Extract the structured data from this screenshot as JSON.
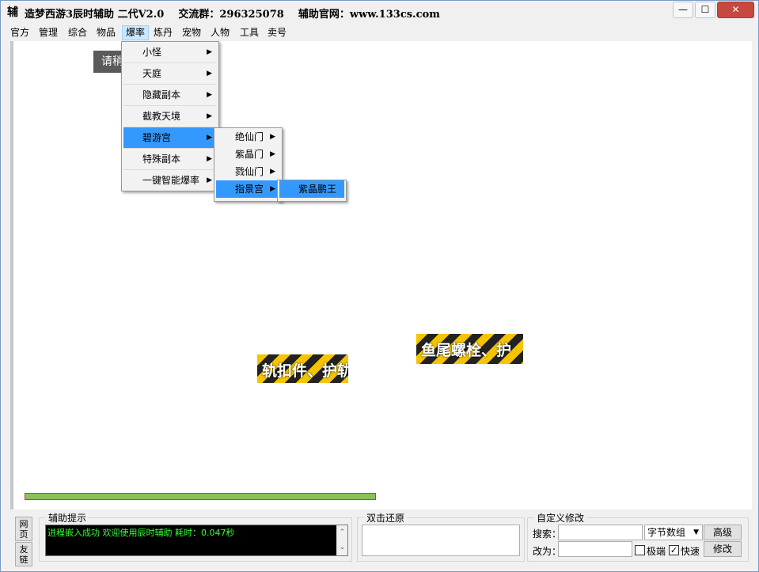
{
  "window": {
    "icon_glyph": "辅",
    "title": "造梦西游3辰时辅助 二代V2.0    交流群：296325078    辅助官网：www.133cs.com",
    "minimize": "—",
    "maximize": "☐",
    "close": "✕"
  },
  "menubar": {
    "items": [
      "官方",
      "管理",
      "综合",
      "物品",
      "爆率",
      "炼丹",
      "宠物",
      "人物",
      "工具",
      "卖号"
    ]
  },
  "content": {
    "wait_text": "请稍",
    "image_text_1": "轨扣件、护轨",
    "image_text_2": "鱼尾螺栓、护"
  },
  "dropdown_main": {
    "items": [
      "小怪",
      "天庭",
      "隐藏副本",
      "截教天境",
      "碧游宫",
      "特殊副本",
      "一键智能爆率"
    ]
  },
  "dropdown_sub": {
    "items": [
      "绝仙门",
      "紫晶门",
      "戮仙门",
      "指景宫"
    ]
  },
  "dropdown_sub2": {
    "items": [
      "紫晶鹏王"
    ]
  },
  "bottom": {
    "side_btn_1": "网页",
    "side_btn_2": "友链",
    "hint_group": "辅助提示",
    "log_text": "进程嵌入成功 欢迎使用辰时辅助 耗时：0.047秒",
    "restore_group": "双击还原",
    "custom_group": "自定义修改",
    "search_label": "搜索：",
    "change_label": "改为：",
    "type_select": "字节数组",
    "advanced_btn": "高级",
    "modify_btn": "修改",
    "extreme_label": "极端",
    "fast_label": "快速",
    "fast_checked": true
  }
}
